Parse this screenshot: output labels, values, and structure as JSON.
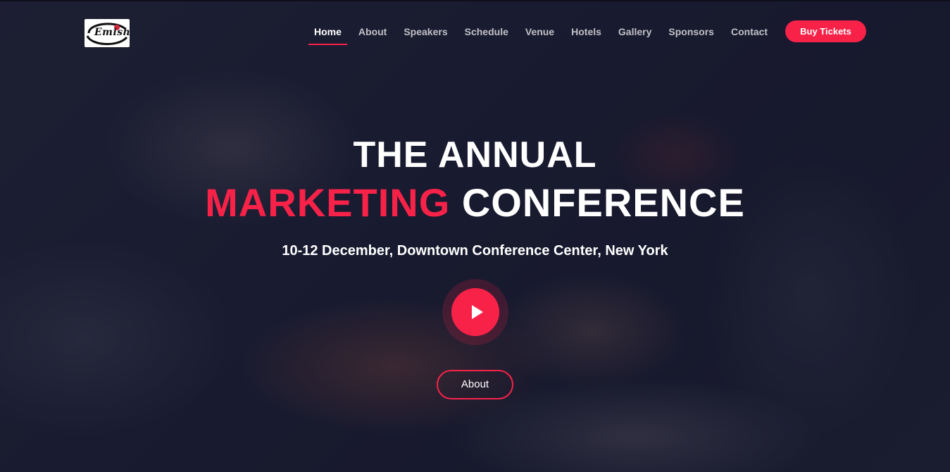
{
  "brand": {
    "logo_text": "Emishi"
  },
  "nav": {
    "items": [
      {
        "label": "Home",
        "active": true
      },
      {
        "label": "About",
        "active": false
      },
      {
        "label": "Speakers",
        "active": false
      },
      {
        "label": "Schedule",
        "active": false
      },
      {
        "label": "Venue",
        "active": false
      },
      {
        "label": "Hotels",
        "active": false
      },
      {
        "label": "Gallery",
        "active": false
      },
      {
        "label": "Sponsors",
        "active": false
      },
      {
        "label": "Contact",
        "active": false
      }
    ],
    "cta_label": "Buy Tickets"
  },
  "hero": {
    "line1": "THE ANNUAL",
    "line2_accent": "MARKETING",
    "line2_rest": "CONFERENCE",
    "subtitle": "10-12 December, Downtown Conference Center, New York",
    "play_icon": "play-icon",
    "about_label": "About"
  },
  "colors": {
    "accent": "#f82249",
    "text": "#ffffff",
    "overlay": "#121428"
  }
}
